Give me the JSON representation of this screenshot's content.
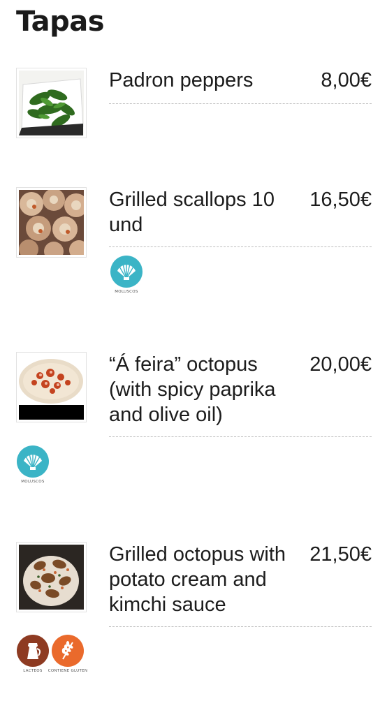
{
  "section": {
    "title": "Tapas"
  },
  "items": [
    {
      "name": "Padron peppers",
      "price": "8,00€",
      "allergens": []
    },
    {
      "name": "Grilled scallops 10 und",
      "price": "16,50€",
      "allergens": [
        {
          "icon": "shell-icon",
          "label": "MOLUSCOS",
          "color": "#3bb4c6"
        }
      ]
    },
    {
      "name": "“Á feira” octopus (with spicy paprika and olive oil)",
      "price": "20,00€",
      "allergens": [
        {
          "icon": "shell-icon",
          "label": "MOLUSCOS",
          "color": "#3bb4c6"
        }
      ]
    },
    {
      "name": "Grilled octopus with potato cream and kimchi sauce",
      "price": "21,50€",
      "allergens": [
        {
          "icon": "milk-jug-icon",
          "label": "LACTEOS",
          "color": "#8e3b22"
        },
        {
          "icon": "wheat-icon",
          "label": "CONTIENE GLUTEN",
          "color": "#ea6a2c"
        }
      ]
    }
  ]
}
